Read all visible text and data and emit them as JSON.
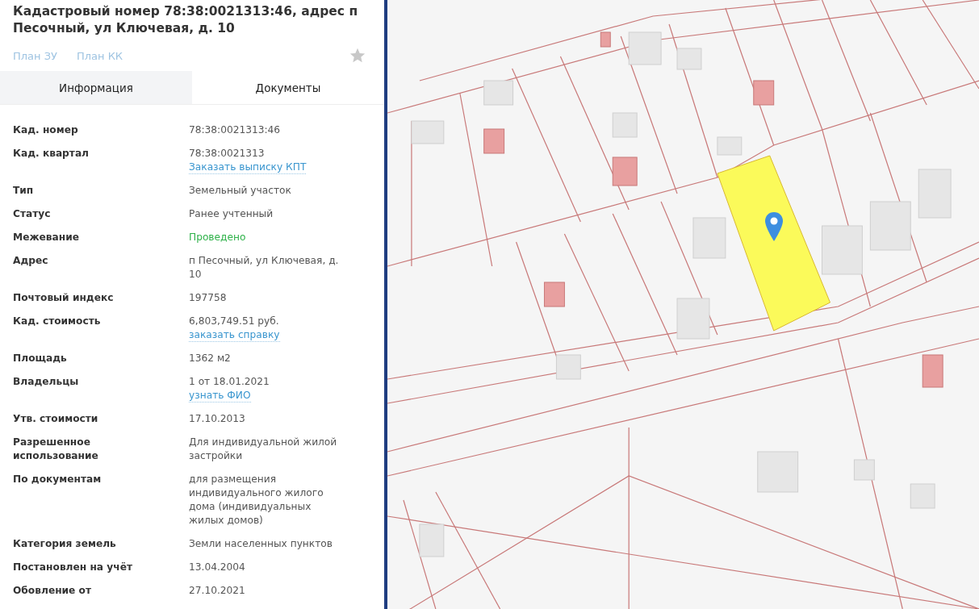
{
  "header": {
    "title": "Кадастровый номер 78:38:0021313:46, адрес п Песочный, ул Ключевая, д. 10",
    "links": [
      "План ЗУ",
      "План КК"
    ],
    "favorite": false
  },
  "tabs": [
    {
      "label": "Информация",
      "selected": true
    },
    {
      "label": "Документы",
      "selected": false
    }
  ],
  "details": [
    {
      "label": "Кад. номер",
      "value": "78:38:0021313:46",
      "highlighted": false
    },
    {
      "label": "Кад. квартал",
      "value": "78:38:0021313",
      "link": "Заказать выписку КПТ",
      "highlighted": false
    },
    {
      "label": "Тип",
      "value": "Земельный участок",
      "highlighted": false
    },
    {
      "label": "Статус",
      "value": "Ранее учтенный",
      "highlighted": false
    },
    {
      "label": "Межевание",
      "value": "Проведено",
      "highlighted": true
    },
    {
      "label": "Адрес",
      "value": "п Песочный, ул Ключевая, д. 10",
      "highlighted": false
    },
    {
      "label": "Почтовый индекс",
      "value": "197758",
      "highlighted": false
    },
    {
      "label": "Кад. стоимость",
      "value": "6,803,749.51 руб.",
      "link": "заказать справку",
      "highlighted": false
    },
    {
      "label": "Площадь",
      "value": "1362 м2",
      "highlighted": false
    },
    {
      "label": "Владельцы",
      "value": "1 от 18.01.2021",
      "link": "узнать ФИО",
      "highlighted": false
    },
    {
      "label": "Утв. стоимости",
      "value": "17.10.2013",
      "highlighted": false
    },
    {
      "label": "Разрешенное использование",
      "value": "Для индивидуальной жилой застройки",
      "highlighted": false
    },
    {
      "label": "По документам",
      "value": "для размещения индивидуального жилого дома (индивидуальных жилых домов)",
      "highlighted": false
    },
    {
      "label": "Категория земель",
      "value": "Земли населенных пунктов",
      "highlighted": false
    },
    {
      "label": "Постановлен на учёт",
      "value": "13.04.2004",
      "highlighted": false
    },
    {
      "label": "Обовление от",
      "value": "27.10.2021",
      "highlighted": false
    }
  ]
}
